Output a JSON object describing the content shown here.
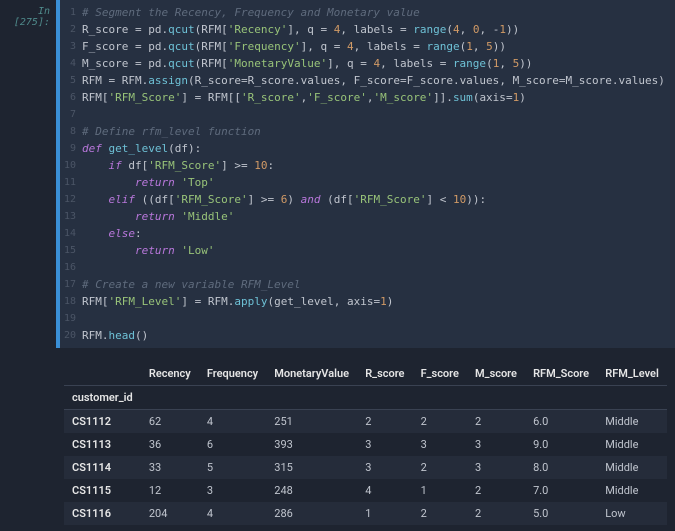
{
  "prompt": "In [275]:",
  "code": {
    "lines": [
      {
        "n": 1,
        "tokens": [
          [
            "cm",
            "# Segment the Recency, Frequency and Monetary value"
          ]
        ]
      },
      {
        "n": 2,
        "tokens": [
          [
            "id",
            "R_score "
          ],
          [
            "op",
            "= "
          ],
          [
            "id",
            "pd"
          ],
          [
            "op",
            "."
          ],
          [
            "fn",
            "qcut"
          ],
          [
            "op",
            "("
          ],
          [
            "id",
            "RFM"
          ],
          [
            "op",
            "["
          ],
          [
            "str",
            "'Recency'"
          ],
          [
            "op",
            "], "
          ],
          [
            "id",
            "q "
          ],
          [
            "op",
            "= "
          ],
          [
            "num",
            "4"
          ],
          [
            "op",
            ", "
          ],
          [
            "id",
            "labels "
          ],
          [
            "op",
            "= "
          ],
          [
            "fn",
            "range"
          ],
          [
            "op",
            "("
          ],
          [
            "num",
            "4"
          ],
          [
            "op",
            ", "
          ],
          [
            "num",
            "0"
          ],
          [
            "op",
            ", "
          ],
          [
            "op",
            "-"
          ],
          [
            "num",
            "1"
          ],
          [
            "op",
            "))"
          ]
        ]
      },
      {
        "n": 3,
        "tokens": [
          [
            "id",
            "F_score "
          ],
          [
            "op",
            "= "
          ],
          [
            "id",
            "pd"
          ],
          [
            "op",
            "."
          ],
          [
            "fn",
            "qcut"
          ],
          [
            "op",
            "("
          ],
          [
            "id",
            "RFM"
          ],
          [
            "op",
            "["
          ],
          [
            "str",
            "'Frequency'"
          ],
          [
            "op",
            "], "
          ],
          [
            "id",
            "q "
          ],
          [
            "op",
            "= "
          ],
          [
            "num",
            "4"
          ],
          [
            "op",
            ", "
          ],
          [
            "id",
            "labels "
          ],
          [
            "op",
            "= "
          ],
          [
            "fn",
            "range"
          ],
          [
            "op",
            "("
          ],
          [
            "num",
            "1"
          ],
          [
            "op",
            ", "
          ],
          [
            "num",
            "5"
          ],
          [
            "op",
            "))"
          ]
        ]
      },
      {
        "n": 4,
        "tokens": [
          [
            "id",
            "M_score "
          ],
          [
            "op",
            "= "
          ],
          [
            "id",
            "pd"
          ],
          [
            "op",
            "."
          ],
          [
            "fn",
            "qcut"
          ],
          [
            "op",
            "("
          ],
          [
            "id",
            "RFM"
          ],
          [
            "op",
            "["
          ],
          [
            "str",
            "'MonetaryValue'"
          ],
          [
            "op",
            "], "
          ],
          [
            "id",
            "q "
          ],
          [
            "op",
            "= "
          ],
          [
            "num",
            "4"
          ],
          [
            "op",
            ", "
          ],
          [
            "id",
            "labels "
          ],
          [
            "op",
            "= "
          ],
          [
            "fn",
            "range"
          ],
          [
            "op",
            "("
          ],
          [
            "num",
            "1"
          ],
          [
            "op",
            ", "
          ],
          [
            "num",
            "5"
          ],
          [
            "op",
            "))"
          ]
        ]
      },
      {
        "n": 5,
        "tokens": [
          [
            "id",
            "RFM "
          ],
          [
            "op",
            "= "
          ],
          [
            "id",
            "RFM"
          ],
          [
            "op",
            "."
          ],
          [
            "fn",
            "assign"
          ],
          [
            "op",
            "("
          ],
          [
            "id",
            "R_score"
          ],
          [
            "op",
            "="
          ],
          [
            "id",
            "R_score"
          ],
          [
            "op",
            "."
          ],
          [
            "id",
            "values"
          ],
          [
            "op",
            ", "
          ],
          [
            "id",
            "F_score"
          ],
          [
            "op",
            "="
          ],
          [
            "id",
            "F_score"
          ],
          [
            "op",
            "."
          ],
          [
            "id",
            "values"
          ],
          [
            "op",
            ", "
          ],
          [
            "id",
            "M_score"
          ],
          [
            "op",
            "="
          ],
          [
            "id",
            "M_score"
          ],
          [
            "op",
            "."
          ],
          [
            "id",
            "values"
          ],
          [
            "op",
            ")"
          ]
        ]
      },
      {
        "n": 6,
        "tokens": [
          [
            "id",
            "RFM"
          ],
          [
            "op",
            "["
          ],
          [
            "str",
            "'RFM_Score'"
          ],
          [
            "op",
            "] "
          ],
          [
            "op",
            "= "
          ],
          [
            "id",
            "RFM"
          ],
          [
            "op",
            "[["
          ],
          [
            "str",
            "'R_score'"
          ],
          [
            "op",
            ","
          ],
          [
            "str",
            "'F_score'"
          ],
          [
            "op",
            ","
          ],
          [
            "str",
            "'M_score'"
          ],
          [
            "op",
            "]]."
          ],
          [
            "fn",
            "sum"
          ],
          [
            "op",
            "("
          ],
          [
            "id",
            "axis"
          ],
          [
            "op",
            "="
          ],
          [
            "num",
            "1"
          ],
          [
            "op",
            ")"
          ]
        ]
      },
      {
        "n": 7,
        "tokens": []
      },
      {
        "n": 8,
        "tokens": [
          [
            "cm",
            "# Define rfm_level function"
          ]
        ]
      },
      {
        "n": 9,
        "tokens": [
          [
            "def",
            "def "
          ],
          [
            "name",
            "get_level"
          ],
          [
            "op",
            "("
          ],
          [
            "id",
            "df"
          ],
          [
            "op",
            "):"
          ]
        ]
      },
      {
        "n": 10,
        "tokens": [
          [
            "id",
            "    "
          ],
          [
            "kw",
            "if"
          ],
          [
            "id",
            " df"
          ],
          [
            "op",
            "["
          ],
          [
            "str",
            "'RFM_Score'"
          ],
          [
            "op",
            "] "
          ],
          [
            "op",
            ">= "
          ],
          [
            "num",
            "10"
          ],
          [
            "op",
            ":"
          ]
        ]
      },
      {
        "n": 11,
        "tokens": [
          [
            "id",
            "        "
          ],
          [
            "kw",
            "return "
          ],
          [
            "str",
            "'Top'"
          ]
        ]
      },
      {
        "n": 12,
        "tokens": [
          [
            "id",
            "    "
          ],
          [
            "kw",
            "elif"
          ],
          [
            "id",
            " "
          ],
          [
            "op",
            "(("
          ],
          [
            "id",
            "df"
          ],
          [
            "op",
            "["
          ],
          [
            "str",
            "'RFM_Score'"
          ],
          [
            "op",
            "] "
          ],
          [
            "op",
            ">= "
          ],
          [
            "num",
            "6"
          ],
          [
            "op",
            ") "
          ],
          [
            "kw",
            "and"
          ],
          [
            "op",
            " ("
          ],
          [
            "id",
            "df"
          ],
          [
            "op",
            "["
          ],
          [
            "str",
            "'RFM_Score'"
          ],
          [
            "op",
            "] "
          ],
          [
            "op",
            "< "
          ],
          [
            "num",
            "10"
          ],
          [
            "op",
            ")):"
          ]
        ]
      },
      {
        "n": 13,
        "tokens": [
          [
            "id",
            "        "
          ],
          [
            "kw",
            "return "
          ],
          [
            "str",
            "'Middle'"
          ]
        ]
      },
      {
        "n": 14,
        "tokens": [
          [
            "id",
            "    "
          ],
          [
            "kw",
            "else"
          ],
          [
            "op",
            ":"
          ]
        ]
      },
      {
        "n": 15,
        "tokens": [
          [
            "id",
            "        "
          ],
          [
            "kw",
            "return "
          ],
          [
            "str",
            "'Low'"
          ]
        ]
      },
      {
        "n": 16,
        "tokens": []
      },
      {
        "n": 17,
        "tokens": [
          [
            "cm",
            "# Create a new variable RFM_Level"
          ]
        ]
      },
      {
        "n": 18,
        "tokens": [
          [
            "id",
            "RFM"
          ],
          [
            "op",
            "["
          ],
          [
            "str",
            "'RFM_Level'"
          ],
          [
            "op",
            "] "
          ],
          [
            "op",
            "= "
          ],
          [
            "id",
            "RFM"
          ],
          [
            "op",
            "."
          ],
          [
            "fn",
            "apply"
          ],
          [
            "op",
            "("
          ],
          [
            "id",
            "get_level"
          ],
          [
            "op",
            ", "
          ],
          [
            "id",
            "axis"
          ],
          [
            "op",
            "="
          ],
          [
            "num",
            "1"
          ],
          [
            "op",
            ")"
          ]
        ]
      },
      {
        "n": 19,
        "tokens": []
      },
      {
        "n": 20,
        "tokens": [
          [
            "id",
            "RFM"
          ],
          [
            "op",
            "."
          ],
          [
            "fn",
            "head"
          ],
          [
            "op",
            "()"
          ]
        ]
      }
    ]
  },
  "table": {
    "columns": [
      "Recency",
      "Frequency",
      "MonetaryValue",
      "R_score",
      "F_score",
      "M_score",
      "RFM_Score",
      "RFM_Level"
    ],
    "index_name": "customer_id",
    "rows": [
      {
        "idx": "CS1112",
        "cells": [
          "62",
          "4",
          "251",
          "2",
          "2",
          "2",
          "6.0",
          "Middle"
        ]
      },
      {
        "idx": "CS1113",
        "cells": [
          "36",
          "6",
          "393",
          "3",
          "3",
          "3",
          "9.0",
          "Middle"
        ]
      },
      {
        "idx": "CS1114",
        "cells": [
          "33",
          "5",
          "315",
          "3",
          "2",
          "3",
          "8.0",
          "Middle"
        ]
      },
      {
        "idx": "CS1115",
        "cells": [
          "12",
          "3",
          "248",
          "4",
          "1",
          "2",
          "7.0",
          "Middle"
        ]
      },
      {
        "idx": "CS1116",
        "cells": [
          "204",
          "4",
          "286",
          "1",
          "2",
          "2",
          "5.0",
          "Low"
        ]
      }
    ]
  }
}
